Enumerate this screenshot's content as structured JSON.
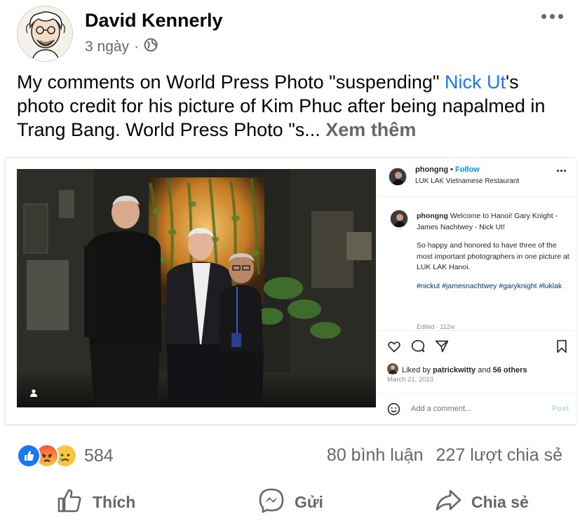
{
  "post": {
    "author": "David Kennerly",
    "time": "3 ngày",
    "separator": "·",
    "privacy_icon": "globe-icon",
    "text_before": "My comments on World Press Photo \"suspending\" ",
    "mention": "Nick Ut",
    "text_after": "'s photo credit for his picture of Kim Phuc after being napalmed in Trang Bang. World Press Photo \"s... ",
    "see_more": "Xem thêm"
  },
  "instagram": {
    "username": "phongng",
    "dot": "•",
    "follow": "Follow",
    "location": "LUK LAK Vietnamese Restaurant",
    "caption_user": "phongng",
    "caption_line1": " Welcome to Hanoi! Gary Knight - James Nachtwey - Nick Ut!",
    "caption_para2": "So happy and honored to have three of the most important photographers in one picture at LUK LAK Hanoi.",
    "hashtags": "#nickut #jamesnachtwey #garyknight #luklak",
    "edited": "Edited · 112w",
    "liked_prefix": "Liked by ",
    "liked_user": "patrickwitty",
    "liked_mid": " and ",
    "liked_count": "56 others",
    "date": "March 21, 2023",
    "comment_placeholder": "Add a comment...",
    "post_button": "Post"
  },
  "reactions": {
    "types": [
      "like-icon",
      "angry-icon",
      "sad-icon"
    ],
    "count": "584",
    "comments": "80 bình luận",
    "shares": "227 lượt chia sẻ"
  },
  "actions": {
    "like": "Thích",
    "send": "Gửi",
    "share": "Chia sẻ"
  },
  "colors": {
    "link_blue": "#1877f2",
    "secondary_gray": "#65676b",
    "ig_follow_blue": "#0095f6"
  }
}
